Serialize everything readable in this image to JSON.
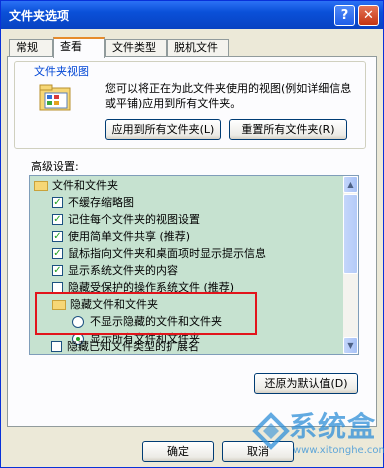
{
  "window": {
    "title": "文件夹选项"
  },
  "tabs": [
    "常规",
    "查看",
    "文件类型",
    "脱机文件"
  ],
  "folder_views": {
    "title": "文件夹视图",
    "description": "您可以将正在为此文件夹使用的视图(例如详细信息或平铺)应用到所有文件夹。",
    "apply_button": "应用到所有文件夹(L)",
    "reset_button": "重置所有文件夹(R)"
  },
  "advanced": {
    "label": "高级设置:",
    "items": [
      {
        "type": "folder",
        "label": "文件和文件夹"
      },
      {
        "type": "checkbox",
        "checked": true,
        "label": "不缓存缩略图"
      },
      {
        "type": "checkbox",
        "checked": true,
        "label": "记住每个文件夹的视图设置"
      },
      {
        "type": "checkbox",
        "checked": true,
        "label": "使用简单文件共享 (推荐)"
      },
      {
        "type": "checkbox",
        "checked": true,
        "label": "鼠标指向文件夹和桌面项时显示提示信息"
      },
      {
        "type": "checkbox",
        "checked": true,
        "label": "显示系统文件夹的内容"
      },
      {
        "type": "checkbox",
        "checked": false,
        "label": "隐藏受保护的操作系统文件 (推荐)"
      },
      {
        "type": "folder",
        "label": "隐藏文件和文件夹"
      },
      {
        "type": "radio",
        "checked": false,
        "label": "不显示隐藏的文件和文件夹"
      },
      {
        "type": "radio",
        "checked": true,
        "label": "显示所有文件和文件夹"
      },
      {
        "type": "checkbox",
        "checked": false,
        "label": "隐藏已知文件类型的扩展名"
      }
    ]
  },
  "restore_button": "还原为默认值(D)",
  "ok_button": "确定",
  "cancel_button": "取消",
  "watermark": {
    "text": "系统盒",
    "url": "www.xitonghe.com"
  },
  "colors": {
    "tree_bg": "#c6e2d0",
    "highlight": "#e2141b",
    "title_bar": "#0a50d8"
  }
}
